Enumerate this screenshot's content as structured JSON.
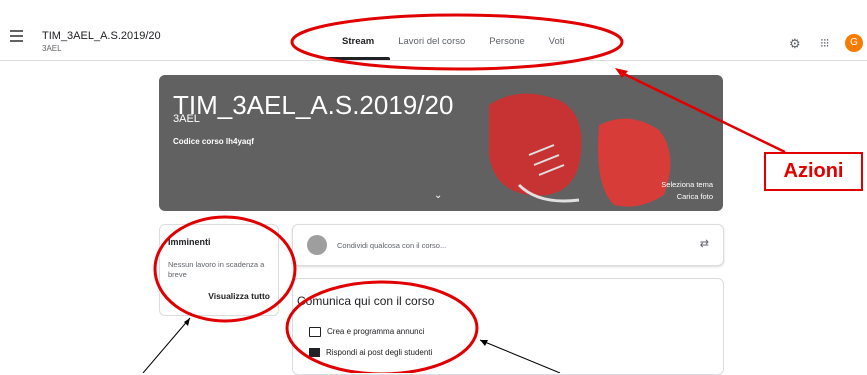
{
  "header": {
    "course_title": "TIM_3AEL_A.S.2019/20",
    "course_section": "3AEL",
    "tabs": [
      {
        "label": "Stream",
        "active": true
      },
      {
        "label": "Lavori del corso",
        "active": false
      },
      {
        "label": "Persone",
        "active": false
      },
      {
        "label": "Voti",
        "active": false
      }
    ],
    "avatar_initial": "G",
    "avatar_color": "#f57c00"
  },
  "banner": {
    "title": "TIM_3AEL_A.S.2019/20",
    "section": "3AEL",
    "code_label": "Codice corso  lh4yaqf",
    "theme_link": "Seleziona tema",
    "photo_link": "Carica foto",
    "background": "#616161"
  },
  "upcoming": {
    "title": "Imminenti",
    "text": "Nessun lavoro in scadenza a breve",
    "link": "Visualizza tutto"
  },
  "share": {
    "placeholder": "Condividi qualcosa con il corso..."
  },
  "communicate": {
    "title": "Comunica qui con il corso",
    "item1": "Crea e programma annunci",
    "item2": "Rispondi ai post degli studenti"
  },
  "annotation": {
    "label": "Azioni",
    "color": "#e00000"
  }
}
